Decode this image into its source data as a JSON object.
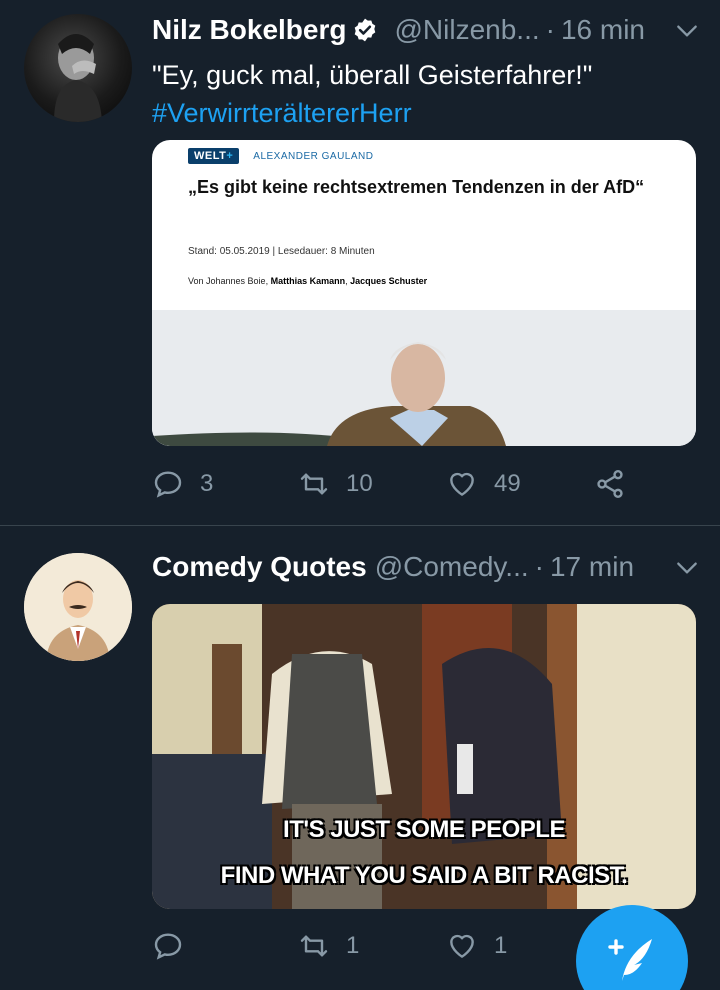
{
  "tweets": [
    {
      "name": "Nilz Bokelberg",
      "handle": "@Nilzenb...",
      "separator": "·",
      "time": "16 min",
      "text": "\"Ey, guck mal, überall Geisterfahrer!\"",
      "hashtag": "#VerwirrterältererHerr",
      "card": {
        "logo": "WELT",
        "logo_plus": "+",
        "category": "ALEXANDER GAULAND",
        "title": "„Es gibt keine rechtsextremen Tendenzen in der AfD“",
        "stand": "Stand: 05.05.2019 | Lesedauer: 8 Minuten",
        "byline_prefix": "Von Johannes Boie, ",
        "author2": "Matthias Kamann",
        "byline_sep": ", ",
        "author3": "Jacques Schuster"
      },
      "replies": "3",
      "retweets": "10",
      "likes": "49"
    },
    {
      "name": "Comedy Quotes",
      "handle": "@Comedy...",
      "separator": "·",
      "time": "17 min",
      "caption_line1": "IT'S JUST SOME PEOPLE",
      "caption_line2": "FIND WHAT YOU SAID A BIT RACIST.",
      "replies": "",
      "retweets": "1",
      "likes": "1"
    }
  ],
  "icons": {
    "verified": "verified-badge-icon",
    "chevron": "chevron-down-icon",
    "reply": "reply-icon",
    "retweet": "retweet-icon",
    "like": "heart-icon",
    "share": "share-icon",
    "compose": "compose-tweet-icon"
  },
  "colors": {
    "background": "#16202b",
    "accent": "#1da1f2",
    "muted": "#8899a6",
    "divider": "#38444d"
  }
}
